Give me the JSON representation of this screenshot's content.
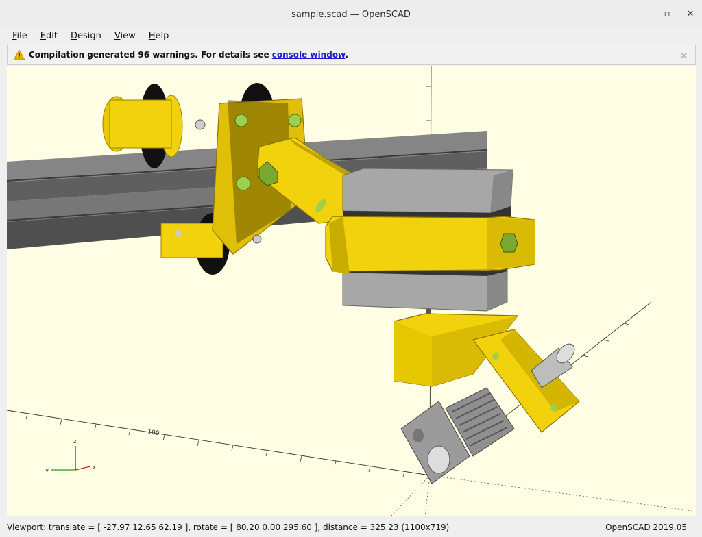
{
  "window": {
    "title": "sample.scad — OpenSCAD",
    "minimize": "–",
    "maximize": "▫",
    "close": "✕"
  },
  "menu": {
    "items": [
      {
        "key": "F",
        "rest": "ile"
      },
      {
        "key": "E",
        "rest": "dit"
      },
      {
        "key": "D",
        "rest": "esign"
      },
      {
        "key": "V",
        "rest": "iew"
      },
      {
        "key": "H",
        "rest": "elp"
      }
    ]
  },
  "warning": {
    "text": "Compilation generated 96 warnings. For details see ",
    "link": "console window",
    "suffix": ".",
    "close": "✕"
  },
  "axes": {
    "x": "x",
    "y": "y",
    "z": "z",
    "scale_label": "100"
  },
  "status": {
    "viewport": "Viewport: translate = [ -27.97 12.65 62.19 ], rotate = [ 80.20 0.00 295.60 ], distance = 325.23 (1100x719)",
    "version": "OpenSCAD 2019.05"
  },
  "colors": {
    "part_yellow": "#f2d20c",
    "background": "#fffde3",
    "rail_gray": "#6f6f6f",
    "motor_gray": "#a8a8a8"
  }
}
